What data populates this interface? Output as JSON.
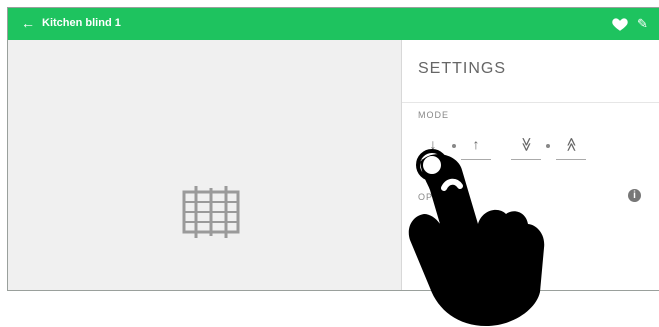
{
  "header": {
    "title": "Kitchen blind 1",
    "back_icon": "arrow-left-icon",
    "favorite_icon": "heart-icon",
    "edit_icon": "pencil-icon"
  },
  "preview": {
    "device_icon": "blind-icon"
  },
  "settings": {
    "title": "SETTINGS",
    "mode_label": "MODE",
    "mode_buttons": [
      {
        "icon": "arrow-down-icon",
        "glyph": "↓"
      },
      {
        "icon": "arrow-up-icon",
        "glyph": "↑"
      },
      {
        "icon": "double-chevron-down-icon",
        "glyph": "≫"
      },
      {
        "icon": "double-chevron-up-icon",
        "glyph": "≪"
      }
    ],
    "options_label": "OP",
    "info_icon": "info-icon",
    "option_icon": "blind-option-icon"
  },
  "overlay": {
    "icon": "pointing-hand-icon"
  },
  "colors": {
    "header": "#1ec35f",
    "left_panel": "#f0f0f0",
    "text_muted": "#666666"
  }
}
